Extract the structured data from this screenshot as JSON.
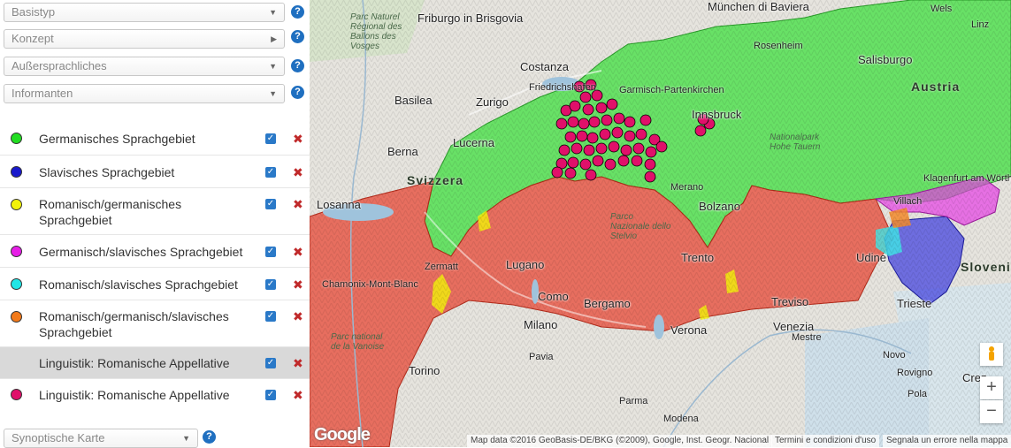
{
  "filters": [
    {
      "label": "Basistyp",
      "arrow": "▼"
    },
    {
      "label": "Konzept",
      "arrow": "▶"
    },
    {
      "label": "Außersprachliches",
      "arrow": "▼"
    },
    {
      "label": "Informanten",
      "arrow": "▼"
    }
  ],
  "help_glyph": "?",
  "legend": [
    {
      "label": "Germanisches Sprachgebiet",
      "color": "#22dd22"
    },
    {
      "label": "Slavisches Sprachgebiet",
      "color": "#1a1acc"
    },
    {
      "label": "Romanisch/germanisches Sprachgebiet",
      "color": "#f2f20a"
    },
    {
      "label": "Germanisch/slavisches Sprachgebiet",
      "color": "#e61ee6"
    },
    {
      "label": "Romanisch/slavisches Sprachgebiet",
      "color": "#22e6e6"
    },
    {
      "label": "Romanisch/germanisch/slavisches Sprachgebiet",
      "color": "#f27a1a"
    },
    {
      "label": "Linguistik: Romanische Appellative",
      "color": ""
    },
    {
      "label": "Linguistik: Romanische Appellative",
      "color": "#e0106a"
    }
  ],
  "check_glyph": "✓",
  "delete_glyph": "✖",
  "synoptic": {
    "label": "Synoptische Karte",
    "arrow": "▼"
  },
  "map": {
    "cities": [
      "München di Baviera",
      "Friburgo in Brisgovia",
      "Costanza",
      "Friedrichshafen",
      "Basilea",
      "Zurigo",
      "Lucerna",
      "Berna",
      "Losanna",
      "Rosenheim",
      "Salisburgo",
      "Garmisch-Partenkirchen",
      "Innsbruck",
      "Merano",
      "Bolzano",
      "Trento",
      "Lugano",
      "Como",
      "Bergamo",
      "Milano",
      "Verona",
      "Treviso",
      "Venezia",
      "Udine",
      "Trieste",
      "Pavia",
      "Torino",
      "Parma",
      "Modena",
      "Wels",
      "Linz",
      "Klagenfurt am Wörthersee",
      "Villach",
      "Chamonix-Mont-Blanc",
      "Zermatt",
      "Mestre",
      "Novo",
      "Rovigno",
      "Pola",
      "Crez"
    ],
    "regions": [
      "Svizzera",
      "Austria",
      "Slovenia"
    ],
    "parks": [
      "Parc Naturel Régional des Ballons des Vosges",
      "Nationalpark Hohe Tauern",
      "Parco Nazionale dello Stelvio",
      "Parc national de la Vanoise"
    ],
    "zoom_in": "+",
    "zoom_out": "−",
    "google": "Google",
    "attribution": "Map data ©2016 GeoBasis-DE/BKG (©2009), Google, Inst. Geogr. Nacional",
    "terms": "Termini e condizioni d'uso",
    "report": "Segnala un errore nella mappa"
  }
}
